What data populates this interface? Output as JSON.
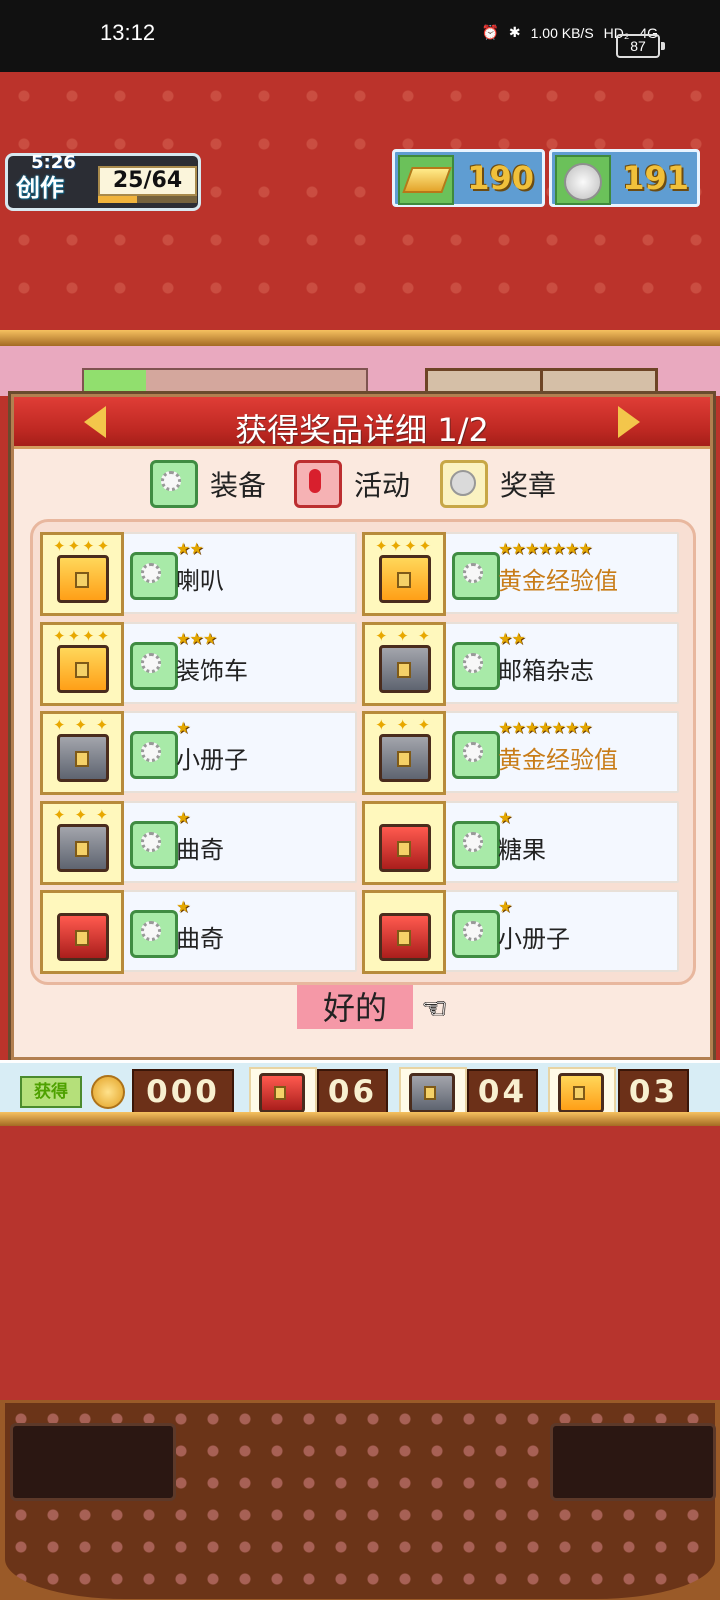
{
  "status_bar": {
    "time": "13:12",
    "network_speed": "1.00 KB/S",
    "hd": "HD₂",
    "signal": "4G",
    "battery": "87"
  },
  "hud": {
    "craft_timer": "5:26",
    "craft_label": "创作",
    "craft_count": "25/64",
    "gold_value": "190",
    "coin_value": "191"
  },
  "dialog": {
    "title": "获得奖品详细 1/2",
    "legend": {
      "equipment": "装备",
      "event": "活动",
      "medal": "奖章"
    },
    "rewards": [
      {
        "name": "喇叭",
        "stars": "★★",
        "chest": "gold",
        "name_color": "normal"
      },
      {
        "name": "黄金经验值",
        "stars": "★★★★★★★",
        "chest": "gold",
        "name_color": "gold"
      },
      {
        "name": "装饰车",
        "stars": "★★★",
        "chest": "gold",
        "name_color": "normal"
      },
      {
        "name": "邮箱杂志",
        "stars": "★★",
        "chest": "silver",
        "name_color": "normal"
      },
      {
        "name": "小册子",
        "stars": "★",
        "chest": "silver",
        "name_color": "normal"
      },
      {
        "name": "黄金经验值",
        "stars": "★★★★★★★",
        "chest": "silver",
        "name_color": "gold"
      },
      {
        "name": "曲奇",
        "stars": "★",
        "chest": "silver",
        "name_color": "normal"
      },
      {
        "name": "糖果",
        "stars": "★",
        "chest": "red",
        "name_color": "normal"
      },
      {
        "name": "曲奇",
        "stars": "★",
        "chest": "red",
        "name_color": "normal"
      },
      {
        "name": "小册子",
        "stars": "★",
        "chest": "red",
        "name_color": "normal"
      }
    ],
    "ok_label": "好的"
  },
  "summary": {
    "label": "获得",
    "coin_count": "000",
    "red_chest_count": "06",
    "silver_chest_count": "04",
    "gold_chest_count": "03"
  },
  "colors": {
    "gold_reward_text": "#c87c18",
    "dialog_header": "#c02923"
  }
}
